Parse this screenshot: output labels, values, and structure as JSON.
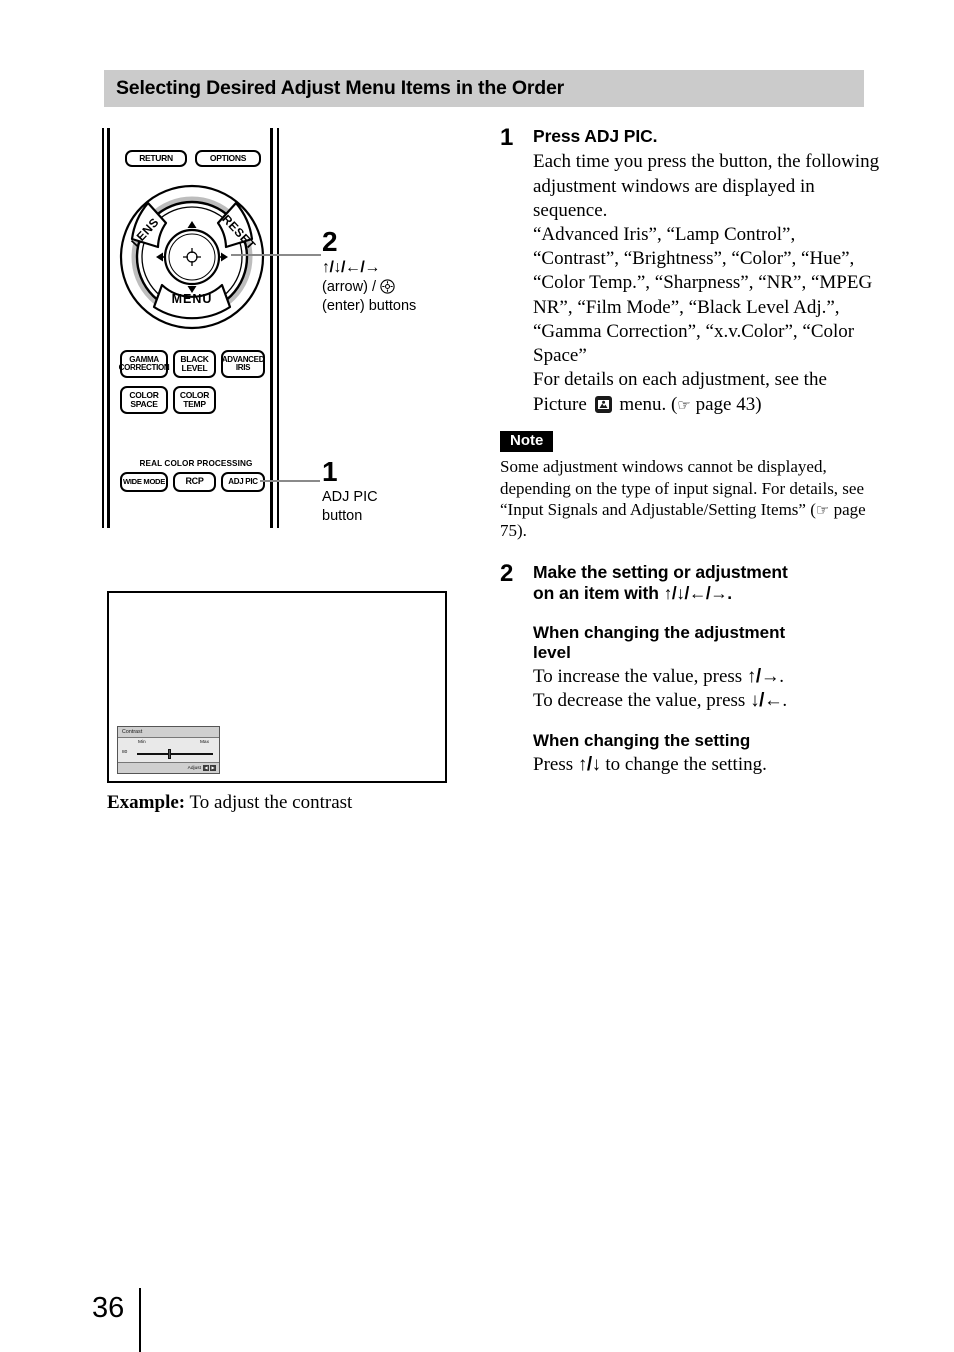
{
  "header": {
    "title": "Selecting Desired Adjust Menu Items in the Order"
  },
  "remote": {
    "buttons": {
      "return": "RETURN",
      "options": "OPTIONS",
      "lens": "LENS",
      "reset": "RESET",
      "menu": "MENU",
      "gamma_correction": "GAMMA CORRECTION",
      "gamma_line1": "GAMMA",
      "gamma_line2": "CORRECTION",
      "black_level_line1": "BLACK",
      "black_level_line2": "LEVEL",
      "advanced_iris_line1": "ADVANCED",
      "advanced_iris_line2": "IRIS",
      "color_space_line1": "COLOR",
      "color_space_line2": "SPACE",
      "color_temp_line1": "COLOR",
      "color_temp_line2": "TEMP",
      "rcp_group_label": "REAL COLOR PROCESSING",
      "wide_mode": "WIDE MODE",
      "rcp": "RCP",
      "adj_pic": "ADJ PIC"
    },
    "callouts": [
      {
        "number": "2",
        "arrows": "↑/↓/←/→",
        "line1_prefix": "(arrow) / ",
        "line2": "(enter) buttons"
      },
      {
        "number": "1",
        "line1": "ADJ PIC",
        "line2": "button"
      }
    ]
  },
  "example": {
    "osd": {
      "title": "Contrast",
      "min_label": "Min",
      "max_label": "Max",
      "value": "80",
      "footer_label": "Adjust",
      "key_left": "◀",
      "key_right": "▶"
    },
    "caption_label": "Example:",
    "caption_text": "To adjust the contrast"
  },
  "steps": [
    {
      "number": "1",
      "heading": "Press ADJ PIC.",
      "paragraphs": [
        "Each time you press the button, the following adjustment windows are displayed in sequence.",
        "“Advanced Iris”, “Lamp Control”, “Contrast”, “Brightness”, “Color”, “Hue”, “Color Temp.”, “Sharpness”, “NR”, “MPEG NR”, “Film Mode”, “Black Level Adj.”, “Gamma Correction”, “x.v.Color”, “Color Space”"
      ],
      "detail_prefix": "For details on each adjustment, see the Picture",
      "detail_suffix": "menu. (",
      "detail_page": "page 43",
      "detail_close": ")"
    },
    {
      "number": "2",
      "heading_line1": "Make the setting or adjustment",
      "heading_line2_prefix": "on an item with ",
      "heading_arrows": "↑/↓/←/→",
      "heading_line2_suffix": ".",
      "subsections": [
        {
          "title_line1": "When changing the adjustment",
          "title_line2": "level",
          "lines": [
            {
              "prefix": "To increase the value, press ",
              "arrows": "↑/→",
              "suffix": "."
            },
            {
              "prefix": "To decrease the value, press ",
              "arrows": "↓/←",
              "suffix": "."
            }
          ]
        },
        {
          "title_line1": "When changing the setting",
          "title_line2": "",
          "lines": [
            {
              "prefix": "Press ",
              "arrows": "↑/↓",
              "suffix": " to change the setting."
            }
          ]
        }
      ]
    }
  ],
  "note": {
    "badge": "Note",
    "text_part1": "Some adjustment windows cannot be displayed, depending on the type of input signal. For details, see “Input Signals and Adjustable/Setting Items” (",
    "page_ref": "page 75",
    "text_part2": ")."
  },
  "footer": {
    "page_number": "36"
  },
  "colors": {
    "header_bg": "#cbcbcb",
    "note_badge_bg": "#000000",
    "leader_line": "#8a8a8a"
  }
}
